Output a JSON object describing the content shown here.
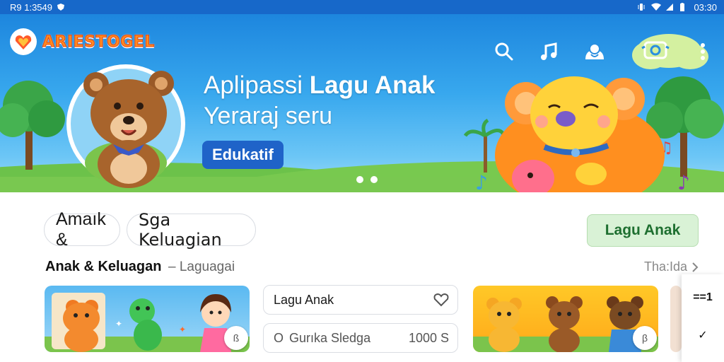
{
  "status_bar": {
    "left_text": "R9 1:3549",
    "time": "03:30",
    "icons": [
      "shield-icon",
      "vibrate-icon",
      "wifi-icon",
      "signal-icon",
      "battery-icon"
    ]
  },
  "app": {
    "brand_name": "ARIESTOGEL"
  },
  "header": {
    "actions": [
      "search-icon",
      "music-note-icon",
      "account-icon",
      "camera-icon",
      "more-vert-icon"
    ]
  },
  "hero": {
    "title_plain": "Aplipassi ",
    "title_bold": "Lagu Anak",
    "subtitle": "Yeraraj seru",
    "badge": "Edukatif",
    "slide_count": 2
  },
  "filters": {
    "chip_1": "Amaık &",
    "chip_2": "Sga Keluagian",
    "primary_button": "Lagu Anak"
  },
  "section": {
    "title": "Anak & Keluagan",
    "subtitle": "– Laguagai",
    "see_all": "Tha:Ida"
  },
  "cards": [
    {
      "badge": "ß"
    },
    {
      "badge": "β"
    }
  ],
  "list": {
    "item_1": {
      "label": "Lagu Anak"
    },
    "item_2": {
      "prefix": "O",
      "label": "Gurıka Sledga",
      "value": "1000 S"
    }
  },
  "side_rail": {
    "item_1": "==1",
    "item_2": "✓"
  },
  "colors": {
    "status_bar": "#1768c9",
    "sky_top": "#1d86de",
    "badge_blue": "#1f63c8",
    "primary_green_bg": "#d9f2d6",
    "primary_green_text": "#1e6f30",
    "brand_orange": "#ff8a1e"
  }
}
